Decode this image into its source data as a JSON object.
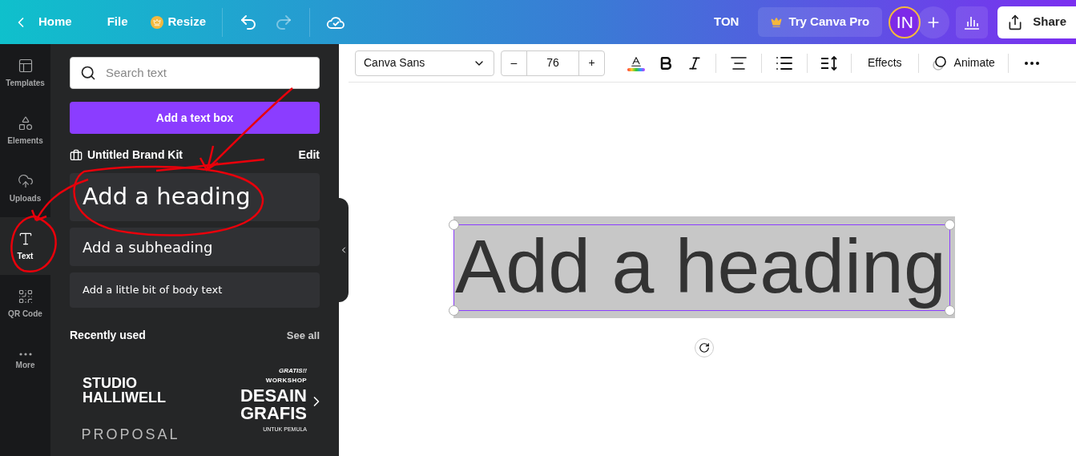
{
  "topbar": {
    "nav": [
      {
        "label": "Home",
        "kind": "back"
      },
      {
        "label": "File",
        "kind": "plain"
      },
      {
        "label": "Resize",
        "kind": "crown"
      }
    ],
    "history": [
      {
        "kind": "undo",
        "disabled": false
      },
      {
        "kind": "redo",
        "disabled": true
      }
    ],
    "user": "TON",
    "pro_button": "Try Canva Pro",
    "avatar": "IN",
    "share": "Share"
  },
  "rail": [
    {
      "label": "Templates",
      "kind": "templates",
      "selected": false
    },
    {
      "label": "Elements",
      "kind": "elements",
      "selected": false
    },
    {
      "label": "Uploads",
      "kind": "uploads",
      "selected": false
    },
    {
      "label": "Text",
      "kind": "text",
      "selected": true
    },
    {
      "label": "QR Code",
      "kind": "qr",
      "selected": false
    },
    {
      "label": "More",
      "kind": "more",
      "selected": false
    }
  ],
  "panel": {
    "search": {
      "placeholder": "Search text"
    },
    "add_button": "Add a text box",
    "brand_kit": "Untitled Brand Kit",
    "edit": "Edit",
    "presets": [
      {
        "label": "Add a heading",
        "kind": "heading"
      },
      {
        "label": "Add a subheading",
        "kind": "subheading"
      },
      {
        "label": "Add a little bit of body text",
        "kind": "body"
      }
    ],
    "recent_title": "Recently used",
    "see_all": "See all",
    "templates": [
      {
        "lines": [
          "STUDIO",
          "HALLIWELL"
        ],
        "footer": "PROPOSAL"
      },
      {
        "top": "GRATIS!!",
        "kicker": "WORKSHOP",
        "lines": [
          "DESAIN",
          "GRAFIS"
        ],
        "footer": "UNTUK PEMULA"
      }
    ]
  },
  "toolbar": {
    "font": "Canva Sans",
    "minus": "–",
    "size": "76",
    "plus": "+",
    "effects": "Effects",
    "animate": "Animate"
  },
  "canvas": {
    "text": "Add a heading"
  }
}
